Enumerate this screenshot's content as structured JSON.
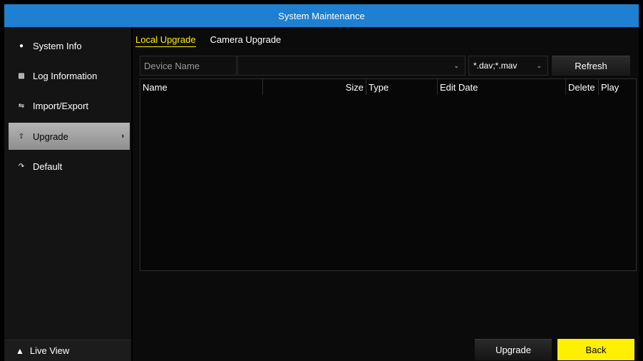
{
  "window": {
    "title": "System Maintenance"
  },
  "sidebar": {
    "items": [
      {
        "label": "System Info",
        "icon": "info-icon"
      },
      {
        "label": "Log Information",
        "icon": "log-icon"
      },
      {
        "label": "Import/Export",
        "icon": "import-export-icon"
      },
      {
        "label": "Upgrade",
        "icon": "upgrade-icon",
        "active": true
      },
      {
        "label": "Default",
        "icon": "default-icon"
      }
    ],
    "live_view": "Live View"
  },
  "tabs": [
    {
      "label": "Local Upgrade",
      "active": true
    },
    {
      "label": "Camera Upgrade"
    }
  ],
  "filter": {
    "device_label": "Device Name",
    "device_value": "",
    "file_filter": "*.dav;*.mav",
    "refresh": "Refresh"
  },
  "table": {
    "columns": [
      "Name",
      "Size",
      "Type",
      "Edit Date",
      "Delete",
      "Play"
    ],
    "rows": []
  },
  "buttons": {
    "upgrade": "Upgrade",
    "back": "Back"
  },
  "colors": {
    "titlebar": "#1f7fd0",
    "accent": "#ffef00",
    "active_item": "#a6a6a6"
  }
}
